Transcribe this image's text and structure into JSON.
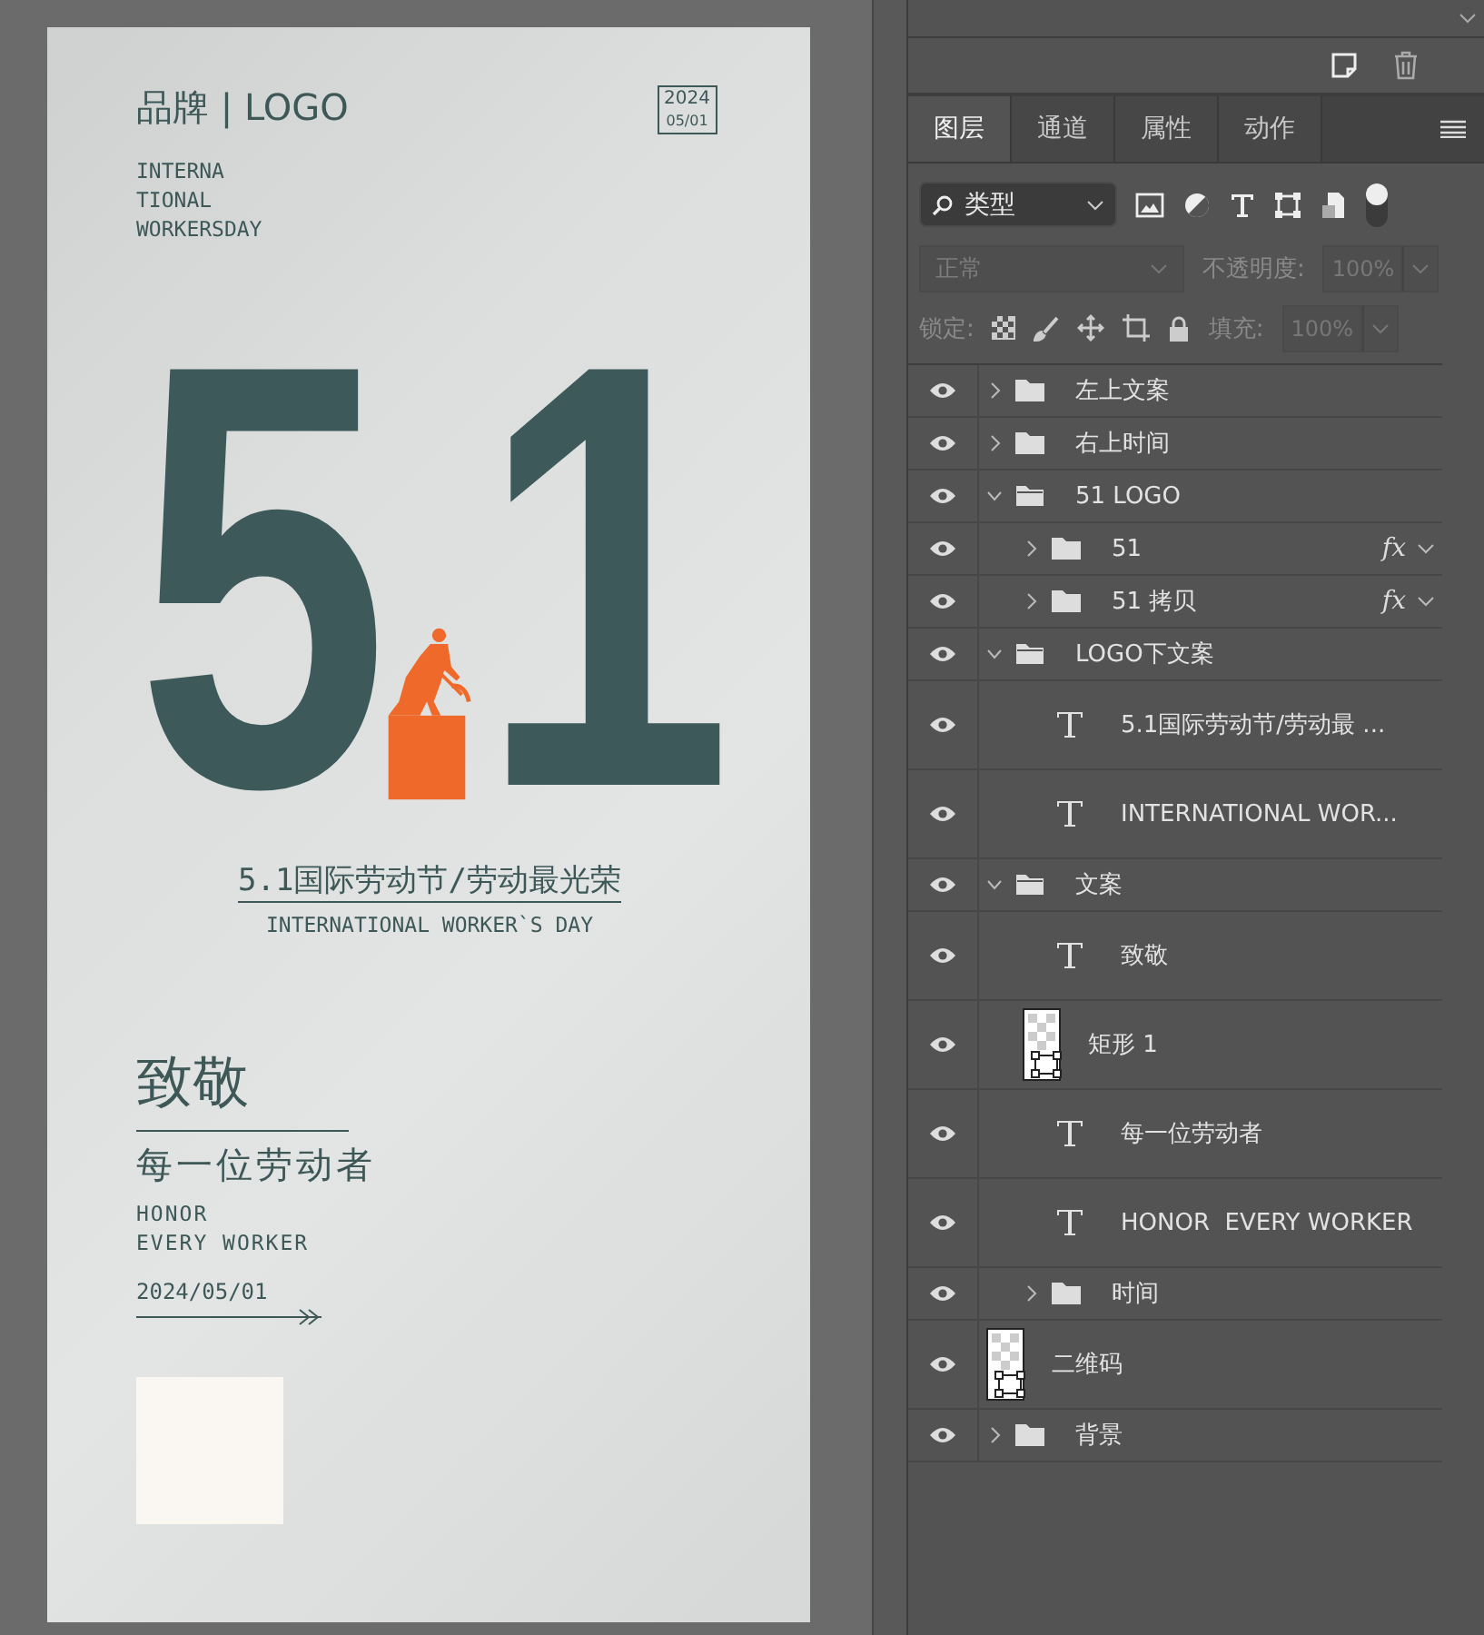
{
  "poster": {
    "brand": "品牌 | LOGO",
    "date_box": [
      "2024",
      "05/01"
    ],
    "intro_lines": [
      "INTERNA",
      "TIONAL",
      "WORKERSDAY"
    ],
    "big_number": [
      "5",
      "1"
    ],
    "headline": "5.1国际劳动节/劳动最光荣",
    "headline_en": "INTERNATIONAL WORKER`S DAY",
    "salute": "致敬",
    "salute_sub": "每一位劳动者",
    "honor_lines": [
      "HONOR",
      "EVERY WORKER"
    ],
    "date": "2024/05/01"
  },
  "layers_panel": {
    "tabs": [
      {
        "label": "图层",
        "selected": true
      },
      {
        "label": "通道",
        "selected": false
      },
      {
        "label": "属性",
        "selected": false
      },
      {
        "label": "动作",
        "selected": false
      }
    ],
    "filter": "类型",
    "blend_mode": "正常",
    "opacity_label": "不透明度:",
    "opacity": "100%",
    "lock_label": "锁定:",
    "fill_label": "填充:",
    "fill": "100%",
    "layers": [
      {
        "kind": "folder",
        "name": "左上文案",
        "visible": true,
        "expanded": false
      },
      {
        "kind": "folder",
        "name": "右上时间",
        "visible": true,
        "expanded": false
      },
      {
        "kind": "folder",
        "name": "51 LOGO",
        "visible": true,
        "expanded": true,
        "children": [
          {
            "kind": "folder",
            "name": "51",
            "visible": true,
            "expanded": false,
            "effect_badge": "fx"
          },
          {
            "kind": "folder",
            "name": "51 拷贝",
            "visible": true,
            "expanded": false,
            "effect_badge": "fx"
          }
        ]
      },
      {
        "kind": "folder",
        "name": "LOGO下文案",
        "visible": true,
        "expanded": true,
        "children": [
          {
            "kind": "text",
            "name": "5.1国际劳动节/劳动最 ...",
            "visible": true
          },
          {
            "kind": "text",
            "name": "INTERNATIONAL WOR...",
            "visible": true
          }
        ]
      },
      {
        "kind": "folder",
        "name": "文案",
        "visible": true,
        "expanded": true,
        "children": [
          {
            "kind": "text",
            "name": "致敬",
            "visible": true
          },
          {
            "kind": "shape",
            "name": "矩形 1",
            "visible": true
          },
          {
            "kind": "text",
            "name": "每一位劳动者",
            "visible": true
          },
          {
            "kind": "text",
            "name": "HONOR  EVERY WORKER",
            "visible": true
          },
          {
            "kind": "folder",
            "name": "时间",
            "visible": true,
            "expanded": false
          }
        ]
      },
      {
        "kind": "shape",
        "name": "二维码",
        "visible": true
      },
      {
        "kind": "folder",
        "name": "背景",
        "visible": true,
        "expanded": false
      }
    ]
  }
}
